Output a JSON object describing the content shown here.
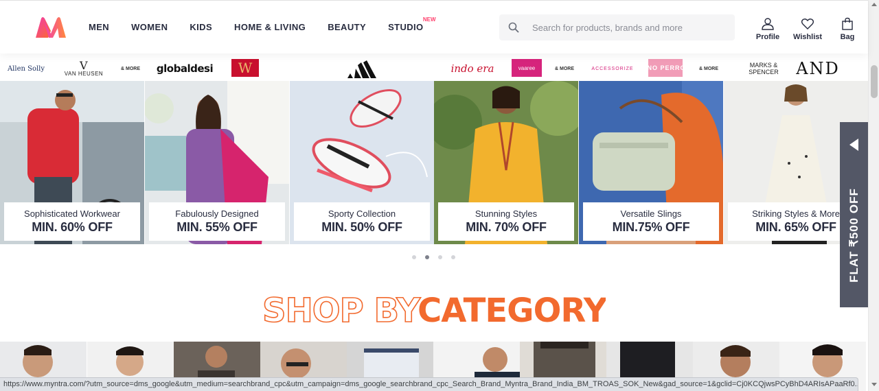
{
  "header": {
    "nav": [
      {
        "label": "MEN"
      },
      {
        "label": "WOMEN"
      },
      {
        "label": "KIDS"
      },
      {
        "label": "HOME & LIVING"
      },
      {
        "label": "BEAUTY"
      },
      {
        "label": "STUDIO",
        "tag": "NEW"
      }
    ],
    "search": {
      "placeholder": "Search for products, brands and more"
    },
    "actions": [
      {
        "label": "Profile",
        "icon": "profile-icon"
      },
      {
        "label": "Wishlist",
        "icon": "heart-icon"
      },
      {
        "label": "Bag",
        "icon": "bag-icon"
      }
    ]
  },
  "brands": {
    "allen_solly": "Allen Solly",
    "van_heusen": "VAN HEUSEN",
    "more1": "& MORE",
    "globaldesi": "globaldesi",
    "w": "W",
    "indo_era": "indo era",
    "vaaree": "vaaree",
    "more2": "& MORE",
    "accessorize": "ACCESSORIZE",
    "lino": "LINO PERROS",
    "more3": "& MORE",
    "marks_line1": "MARKS &",
    "marks_line2": "SPENCER",
    "and": "AND"
  },
  "banners": [
    {
      "title": "Sophisticated Workwear",
      "offer": "MIN. 60% OFF"
    },
    {
      "title": "Fabulously Designed",
      "offer": "MIN. 55% OFF"
    },
    {
      "title": "Sporty Collection",
      "offer": "MIN. 50% OFF"
    },
    {
      "title": "Stunning Styles",
      "offer": "MIN. 70% OFF"
    },
    {
      "title": "Versatile Slings",
      "offer": "MIN.75% OFF"
    },
    {
      "title": "Striking Styles & More",
      "offer": "MIN. 65% OFF"
    }
  ],
  "carousel": {
    "slides": 4,
    "active": 2
  },
  "section": {
    "title_outline": "SHOP BY",
    "title_fill": "CATEGORY"
  },
  "flat_offer": {
    "label": "FLAT ₹500 OFF"
  },
  "status_url": "https://www.myntra.com/?utm_source=dms_google&utm_medium=searchbrand_cpc&utm_campaign=dms_google_searchbrand_cpc_Search_Brand_Myntra_Brand_India_BM_TROAS_SOK_New&gad_source=1&gclid=Cj0KCQjwsPCyBhD4ARIsAPaaRf0...",
  "colors": {
    "accent": "#ff3f6c",
    "category_orange": "#f26a2e",
    "dark_text": "#282c3f"
  }
}
